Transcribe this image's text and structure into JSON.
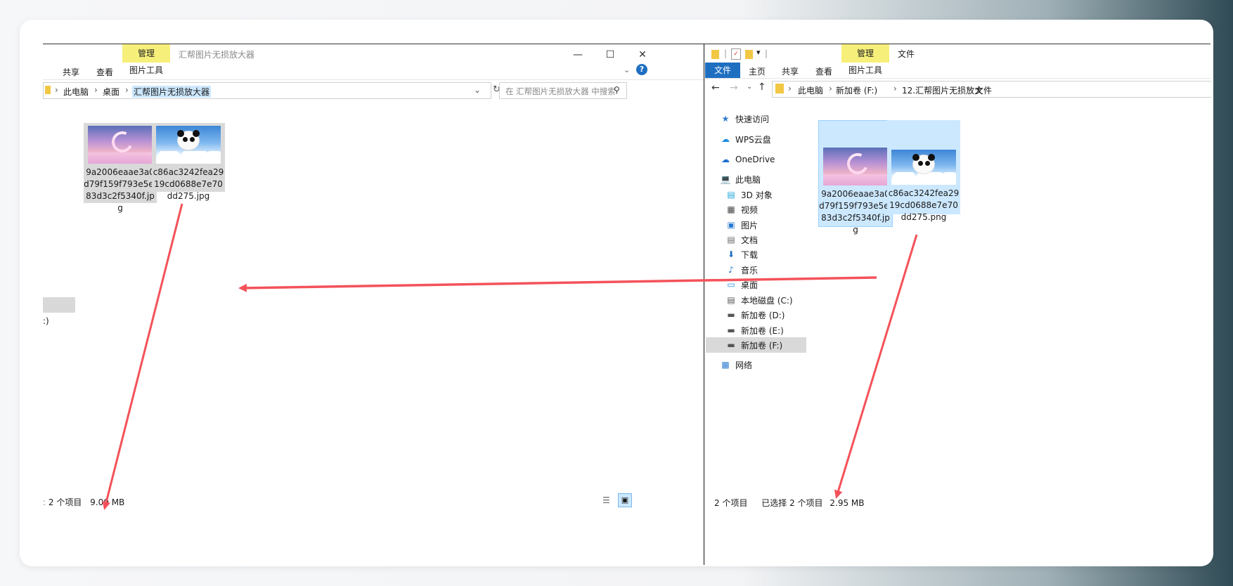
{
  "left_window": {
    "ribbon_tab_manage": "管理",
    "title": "汇帮图片无损放大器",
    "tab_share": "共享",
    "tab_view": "查看",
    "tab_picture_tools": "图片工具",
    "breadcrumb": [
      "此电脑",
      "桌面",
      "汇帮图片无损放大器"
    ],
    "search_placeholder": "在 汇帮图片无损放大器 中搜索",
    "files": [
      {
        "name": "9a2006eaae3a0d79f159f793e5ef83d3c2f5340f.jpg"
      },
      {
        "name": "c86ac3242fea2919cd0688e7e70dd275.jpg"
      }
    ],
    "nav_fragment": ":)",
    "status_prefix": "2 个项目",
    "status_size": "9.00 MB"
  },
  "right_window": {
    "ribbon_tab_manage": "管理",
    "title": "文件",
    "tab_file": "文件",
    "tab_home": "主页",
    "tab_share": "共享",
    "tab_view": "查看",
    "tab_picture_tools": "图片工具",
    "breadcrumb": [
      "此电脑",
      "新加卷 (F:)",
      "12.汇帮图片无损放大",
      "文件"
    ],
    "nav": [
      {
        "label": "快速访问",
        "icon": "star-icon"
      },
      {
        "label": "WPS云盘",
        "icon": "cloud-icon"
      },
      {
        "label": "OneDrive",
        "icon": "onedrive-icon"
      },
      {
        "label": "此电脑",
        "icon": "computer-icon"
      },
      {
        "label": "3D 对象",
        "icon": "cube-icon"
      },
      {
        "label": "视频",
        "icon": "video-icon"
      },
      {
        "label": "图片",
        "icon": "picture-icon"
      },
      {
        "label": "文档",
        "icon": "document-icon"
      },
      {
        "label": "下载",
        "icon": "download-icon"
      },
      {
        "label": "音乐",
        "icon": "music-icon"
      },
      {
        "label": "桌面",
        "icon": "desktop-icon"
      },
      {
        "label": "本地磁盘 (C:)",
        "icon": "drive-icon"
      },
      {
        "label": "新加卷 (D:)",
        "icon": "drive-icon"
      },
      {
        "label": "新加卷 (E:)",
        "icon": "drive-icon"
      },
      {
        "label": "新加卷 (F:)",
        "icon": "drive-icon"
      },
      {
        "label": "网络",
        "icon": "network-icon"
      }
    ],
    "files": [
      {
        "name": "9a2006eaae3a0d79f159f793e5ef83d3c2f5340f.jpg"
      },
      {
        "name": "c86ac3242fea2919cd0688e7e70dd275.png"
      }
    ],
    "status_count": "2 个项目",
    "status_selected": "已选择 2 个项目",
    "status_size": "2.95 MB"
  },
  "colors": {
    "ribbon_manage": "#f6f07a",
    "file_tab": "#1f6fc1",
    "selection": "#cce8ff",
    "arrow": "#f4525a"
  }
}
